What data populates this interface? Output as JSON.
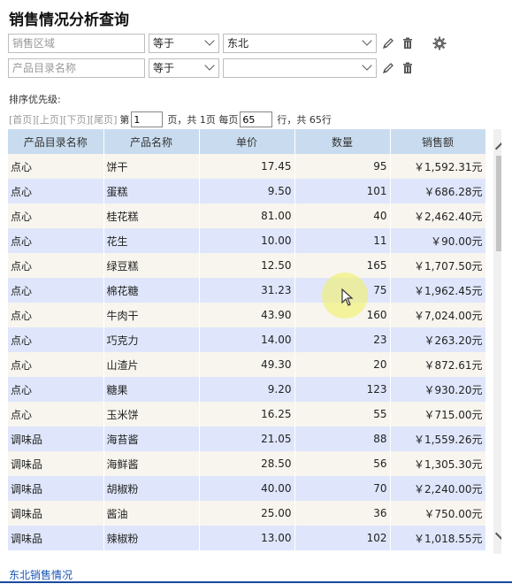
{
  "title": "销售情况分析查询",
  "filters": [
    {
      "field_placeholder": "销售区域",
      "operator": "等于",
      "value": "东北"
    },
    {
      "field_placeholder": "产品目录名称",
      "operator": "等于",
      "value": ""
    }
  ],
  "sort_label": "排序优先级:",
  "pager": {
    "first": "[首页]",
    "prev": "[上页]",
    "next": "[下页]",
    "last": "[尾页]",
    "page_prefix": "第",
    "page_value": "1",
    "page_suffix": "页，共 1页 每页",
    "per_page_value": "65",
    "rows_suffix": "行，共 65行"
  },
  "table": {
    "headers": [
      "产品目录名称",
      "产品名称",
      "单价",
      "数量",
      "销售额"
    ],
    "rows": [
      [
        "点心",
        "饼干",
        "17.45",
        "95",
        "￥1,592.31元"
      ],
      [
        "点心",
        "蛋糕",
        "9.50",
        "101",
        "￥686.28元"
      ],
      [
        "点心",
        "桂花糕",
        "81.00",
        "40",
        "￥2,462.40元"
      ],
      [
        "点心",
        "花生",
        "10.00",
        "11",
        "￥90.00元"
      ],
      [
        "点心",
        "绿豆糕",
        "12.50",
        "165",
        "￥1,707.50元"
      ],
      [
        "点心",
        "棉花糖",
        "31.23",
        "75",
        "￥1,962.45元"
      ],
      [
        "点心",
        "牛肉干",
        "43.90",
        "160",
        "￥7,024.00元"
      ],
      [
        "点心",
        "巧克力",
        "14.00",
        "23",
        "￥263.20元"
      ],
      [
        "点心",
        "山渣片",
        "49.30",
        "20",
        "￥872.61元"
      ],
      [
        "点心",
        "糖果",
        "9.20",
        "123",
        "￥930.20元"
      ],
      [
        "点心",
        "玉米饼",
        "16.25",
        "55",
        "￥715.00元"
      ],
      [
        "调味品",
        "海苔酱",
        "21.05",
        "88",
        "￥1,559.26元"
      ],
      [
        "调味品",
        "海鲜酱",
        "28.50",
        "56",
        "￥1,305.30元"
      ],
      [
        "调味品",
        "胡椒粉",
        "40.00",
        "70",
        "￥2,240.00元"
      ],
      [
        "调味品",
        "酱油",
        "25.00",
        "36",
        "￥750.00元"
      ],
      [
        "调味品",
        "辣椒粉",
        "13.00",
        "102",
        "￥1,018.55元"
      ]
    ]
  },
  "footer_link": "东北销售情况",
  "icons": {
    "edit": "pencil-icon",
    "delete": "trash-icon",
    "settings": "gear-icon"
  },
  "colors": {
    "header_bg": "#c9dcef",
    "row_odd": "#f7f5ee",
    "row_even": "#dfe6fb",
    "link": "#1a55b5"
  }
}
